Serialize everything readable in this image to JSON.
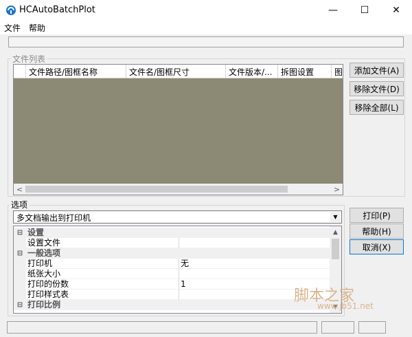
{
  "window": {
    "title": "HCAutoBatchPlot",
    "minimize": "—",
    "maximize": "☐",
    "close": "✕"
  },
  "menu": [
    {
      "label": "文件"
    },
    {
      "label": "帮助"
    }
  ],
  "file_list": {
    "group_label": "文件列表",
    "columns": [
      "",
      "文件路径/图框名称",
      "文件名/图框尺寸",
      "文件版本/...",
      "拆图设置",
      "图"
    ],
    "scroll_left": "<",
    "scroll_right": ">"
  },
  "file_buttons": {
    "add": "添加文件(A)",
    "remove": "移除文件(D)",
    "remove_all": "移除全部(L)"
  },
  "options": {
    "group_label": "选项",
    "combo_value": "多文档输出到打印机",
    "combo_arrow": "▼",
    "rows": [
      {
        "kind": "cat",
        "toggle": "⊟",
        "name": "设置",
        "value": ""
      },
      {
        "kind": "prop",
        "toggle": "",
        "name": "设置文件",
        "value": ""
      },
      {
        "kind": "cat",
        "toggle": "⊟",
        "name": "一般选项",
        "value": ""
      },
      {
        "kind": "prop",
        "toggle": "",
        "name": "打印机",
        "value": "无"
      },
      {
        "kind": "prop",
        "toggle": "",
        "name": "纸张大小",
        "value": ""
      },
      {
        "kind": "prop",
        "toggle": "",
        "name": "打印的份数",
        "value": "1"
      },
      {
        "kind": "prop",
        "toggle": "",
        "name": "打印样式表",
        "value": ""
      },
      {
        "kind": "cat",
        "toggle": "⊟",
        "name": "打印比例",
        "value": ""
      }
    ],
    "scroll_up": "▲",
    "scroll_down": "▼"
  },
  "action_buttons": {
    "print": "打印(P)",
    "help": "帮助(H)",
    "cancel": "取消(X)"
  },
  "watermark": {
    "text": "脚本之家",
    "url": "www.jb51.net"
  }
}
